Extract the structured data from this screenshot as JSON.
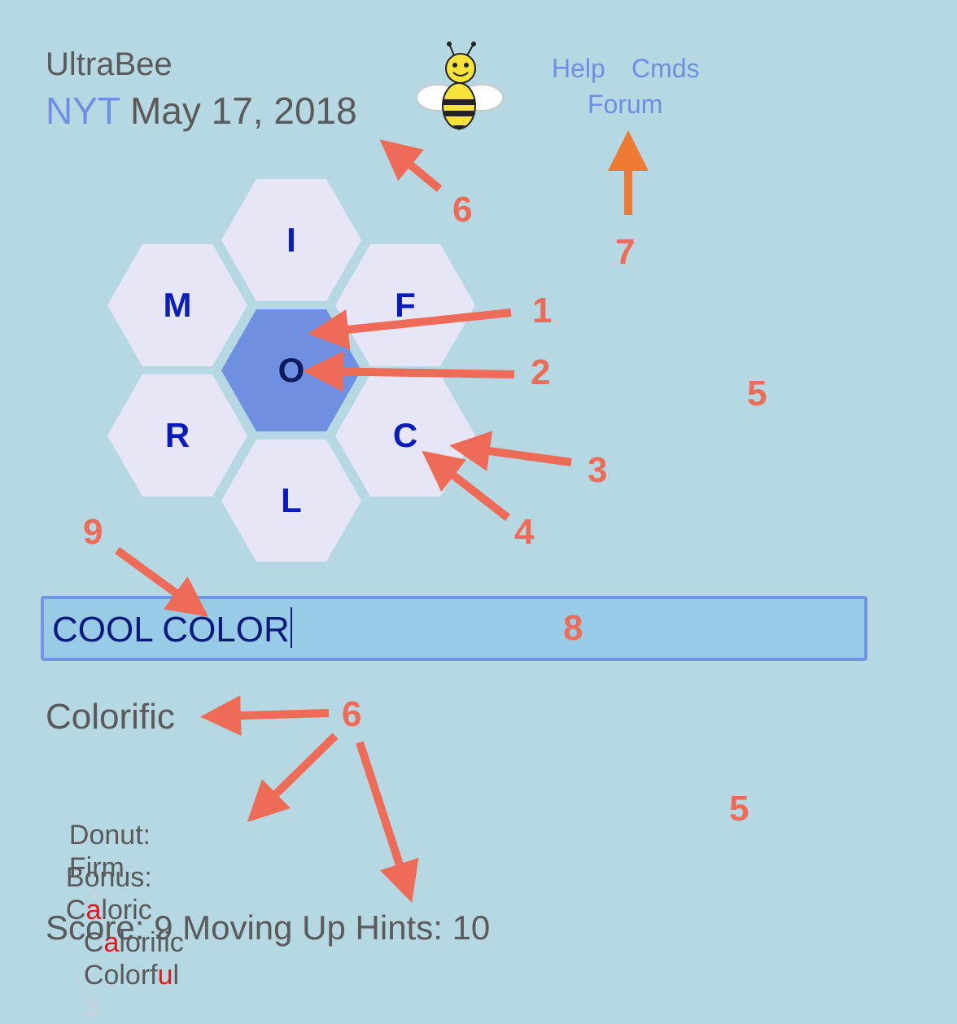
{
  "header": {
    "app_title": "UltraBee",
    "source": "NYT",
    "date": "May 17, 2018"
  },
  "nav": {
    "help": "Help",
    "cmds": "Cmds",
    "forum": "Forum"
  },
  "hive": {
    "center": "O",
    "outer": [
      "I",
      "M",
      "F",
      "R",
      "C",
      "L"
    ],
    "colors": {
      "outer_fill": "#e6e6f7",
      "center_fill": "#6f8fe0",
      "letter": "#0a1db8"
    }
  },
  "entry": {
    "value": "COOL COLOR"
  },
  "current_word": "Colorific",
  "donut": {
    "label": "Donut:",
    "words": [
      "Firm"
    ],
    "count": "1"
  },
  "bonus": {
    "label": "Bonus:",
    "words": [
      {
        "pre": "C",
        "hl": "a",
        "post": "loric"
      },
      {
        "pre": "C",
        "hl": "a",
        "post": "lorific"
      },
      {
        "pre": "Colorf",
        "hl": "u",
        "post": "l"
      }
    ],
    "count": "3"
  },
  "status": {
    "score_label": "Score:",
    "score": "9",
    "rank": "Moving Up",
    "hints_label": "Hints:",
    "hints": "10"
  },
  "annotations": {
    "n1": "1",
    "n2": "2",
    "n3": "3",
    "n4": "4",
    "n5a": "5",
    "n5b": "5",
    "n6a": "6",
    "n6b": "6",
    "n7": "7",
    "n8": "8",
    "n9": "9"
  },
  "colors": {
    "background": "#b5d8e3",
    "accent": "#6f8fe0",
    "annotation": "#ee6b57",
    "highlight": "#e01818"
  }
}
